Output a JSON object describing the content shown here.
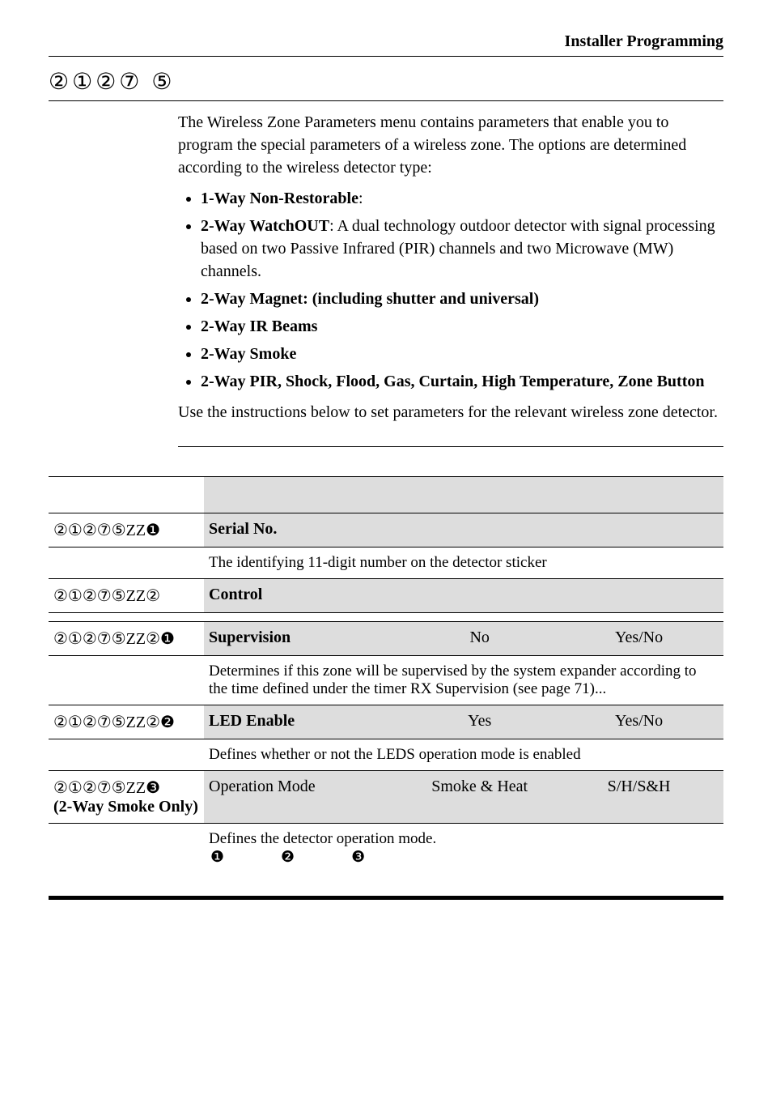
{
  "running_head": "Installer Programming",
  "section_number": "②①②⑦ ⑤",
  "intro": {
    "para1": "The Wireless Zone Parameters menu contains parameters that enable you to program the special parameters of a wireless zone. The options are determined according to the wireless detector type:",
    "b1_label": "1-Way Non-Restorable",
    "b1_after": ":",
    "b2_label": "2-Way WatchOUT",
    "b2_after": ": A dual technology outdoor detector with signal processing based on two Passive Infrared (PIR) channels and two Microwave (MW) channels.",
    "b3_label": "2-Way Magnet: (including shutter and universal)",
    "b4_label": "2-Way IR Beams",
    "b5_label": "2-Way Smoke",
    "b6_label": "2-Way PIR, Shock, Flood, Gas, Curtain, High Temperature, Zone Button",
    "para2": "Use the instructions below to set parameters for the relevant wireless zone detector."
  },
  "rows": {
    "serial": {
      "code": "②①②⑦⑤ZZ❶",
      "title": "Serial No.",
      "desc": "The identifying 11-digit number on the detector sticker"
    },
    "control": {
      "code": "②①②⑦⑤ZZ②",
      "title": "Control"
    },
    "supervision": {
      "code": "②①②⑦⑤ZZ②❶",
      "title": "Supervision",
      "default": "No",
      "range": "Yes/No",
      "desc": "Determines if this zone will be supervised by the system expander according to the time defined under the timer RX Supervision (see page 71)..."
    },
    "led": {
      "code": "②①②⑦⑤ZZ②❷",
      "title": "LED Enable",
      "default": "Yes",
      "range": "Yes/No",
      "desc": "Defines whether or not the LEDS operation mode is enabled"
    },
    "opmode": {
      "code": "②①②⑦⑤ZZ❸",
      "code_sub": "(2-Way Smoke Only)",
      "title": "Operation Mode",
      "default": "Smoke & Heat",
      "range": "S/H/S&H",
      "desc": "Defines the detector operation mode.",
      "markers": "❶❷❸"
    }
  }
}
